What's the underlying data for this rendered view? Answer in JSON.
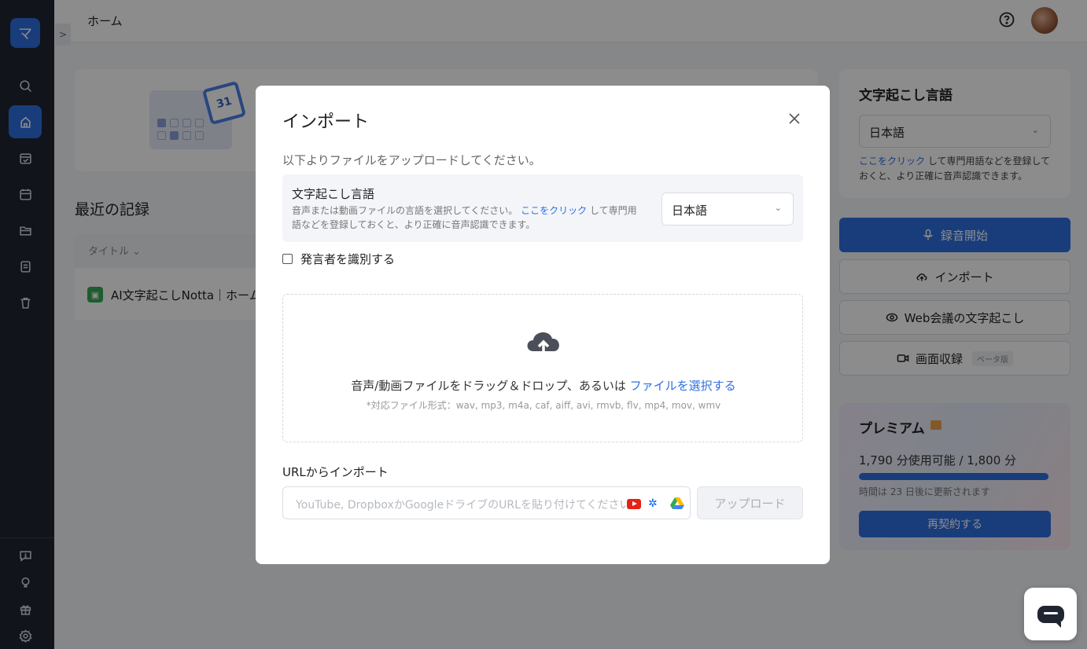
{
  "app": {
    "logo_glyph": "マ",
    "breadcrumb": "ホーム",
    "colors": {
      "accent": "#2f6fe1",
      "rail": "#1f2531",
      "overlay": "rgba(0,0,0,0.45)"
    }
  },
  "rail": {
    "items": [
      "search-icon",
      "home-icon",
      "calendar-check-icon",
      "calendar-icon",
      "folder-icon",
      "notes-icon",
      "trash-icon"
    ],
    "bottom_items": [
      "feedback-icon",
      "lightbulb-icon",
      "gift-icon",
      "settings-icon"
    ],
    "active": "home-icon"
  },
  "hero": {
    "calendar_day": "31"
  },
  "recent": {
    "title": "最近の記録",
    "column_title": "タイトル ⌄",
    "rows": [
      {
        "title": "AI文字起こしNotta｜ホーム"
      }
    ]
  },
  "right_panel": {
    "lang_title": "文字起こし言語",
    "lang_value": "日本語",
    "note_link": "ここをクリック",
    "note_text": " して専門用語などを登録しておくと、より正確に音声認識できます。",
    "record_button": "録音開始",
    "import_button": "インポート",
    "web_meeting_button": "Web会議の文字起こし",
    "screen_record_button": "画面収録",
    "beta_badge": "ベータ版"
  },
  "premium": {
    "title": "プレミアム",
    "usage": "1,790 分使用可能 / 1,800 分",
    "usage_fraction": 0.994,
    "reset": "時間は 23 日後に更新されます",
    "renew_button": "再契約する"
  },
  "modal": {
    "title": "インポート",
    "intro": "以下よりファイルをアップロードしてください。",
    "lang_title": "文字起こし言語",
    "lang_desc_pre": "音声または動画ファイルの言語を選択してください。 ",
    "lang_desc_link": "ここをクリック",
    "lang_desc_post": " して専門用語などを登録しておくと、より正確に音声認識できます。",
    "lang_value": "日本語",
    "speaker_label": "発言者を識別する",
    "drop_text": "音声/動画ファイルをドラッグ＆ドロップ、あるいは ",
    "drop_link": "ファイルを選択する",
    "formats": "*対応ファイル形式：wav, mp3, m4a, caf, aiff, avi, rmvb, flv, mp4, mov, wmv",
    "url_label": "URLからインポート",
    "url_placeholder": "YouTube, DropboxかGoogleドライブのURLを貼り付けてください",
    "upload_button": "アップロード"
  }
}
